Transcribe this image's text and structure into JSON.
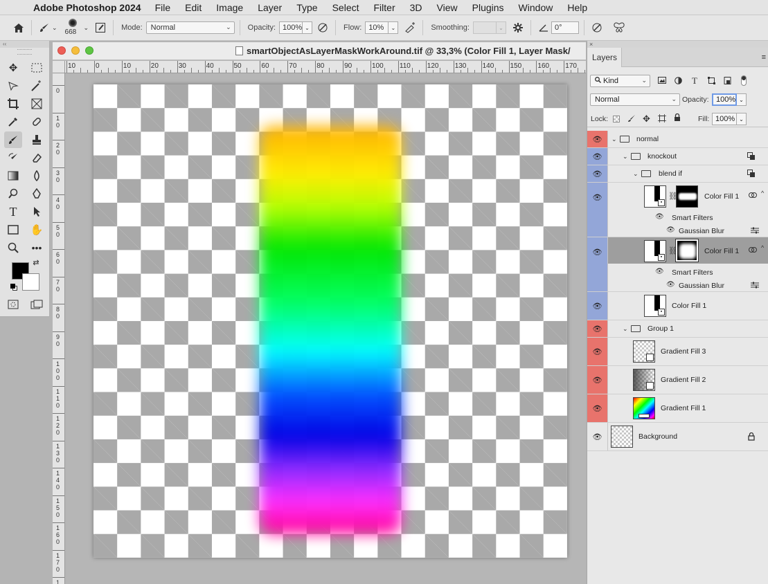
{
  "menubar": {
    "app_name": "Adobe Photoshop 2024",
    "items": [
      "File",
      "Edit",
      "Image",
      "Layer",
      "Type",
      "Select",
      "Filter",
      "3D",
      "View",
      "Plugins",
      "Window",
      "Help"
    ]
  },
  "options": {
    "brush_size": "668",
    "mode_label": "Mode:",
    "mode_value": "Normal",
    "opacity_label": "Opacity:",
    "opacity_value": "100%",
    "flow_label": "Flow:",
    "flow_value": "10%",
    "smoothing_label": "Smoothing:",
    "angle_value": "0°"
  },
  "document": {
    "title": "smartObjectAsLayerMaskWorkAround.tif @ 33,3% (Color Fill 1, Layer Mask/",
    "hruler_labels": [
      "10",
      "0",
      "10",
      "20",
      "30",
      "40",
      "50",
      "60",
      "70",
      "80",
      "90",
      "100",
      "110",
      "120",
      "130",
      "140",
      "150",
      "160",
      "170"
    ],
    "vruler_labels": [
      "0",
      "1\n0",
      "2\n0",
      "3\n0",
      "4\n0",
      "5\n0",
      "6\n0",
      "7\n0",
      "8\n0",
      "9\n0",
      "1\n0\n0",
      "1\n1\n0",
      "1\n2\n0",
      "1\n3\n0",
      "1\n4\n0",
      "1\n5\n0",
      "1\n6\n0",
      "1\n7\n0",
      "1"
    ]
  },
  "layers_panel": {
    "tab": "Layers",
    "filter_kind": "Kind",
    "blend_mode": "Normal",
    "opacity_label": "Opacity:",
    "opacity_value": "100%",
    "lock_label": "Lock:",
    "fill_label": "Fill:",
    "fill_value": "100%",
    "rows": {
      "normal": "normal",
      "knockout": "knockout",
      "blend_if": "blend if",
      "color_fill_a": "Color Fill 1",
      "smart_filters_a": "Smart Filters",
      "gaussian_blur_a": "Gaussian Blur",
      "color_fill_b": "Color Fill 1",
      "smart_filters_b": "Smart Filters",
      "gaussian_blur_b": "Gaussian Blur",
      "color_fill_c": "Color Fill 1",
      "group_1": "Group 1",
      "gradient_fill_3": "Gradient Fill 3",
      "gradient_fill_2": "Gradient Fill 2",
      "gradient_fill_1": "Gradient Fill 1",
      "background": "Background"
    }
  },
  "colors": {
    "eye_red": "#e8736c",
    "eye_blue": "#93a6d8",
    "selected_row": "#9e9e9e",
    "foreground": "#000000",
    "background": "#ffffff"
  }
}
